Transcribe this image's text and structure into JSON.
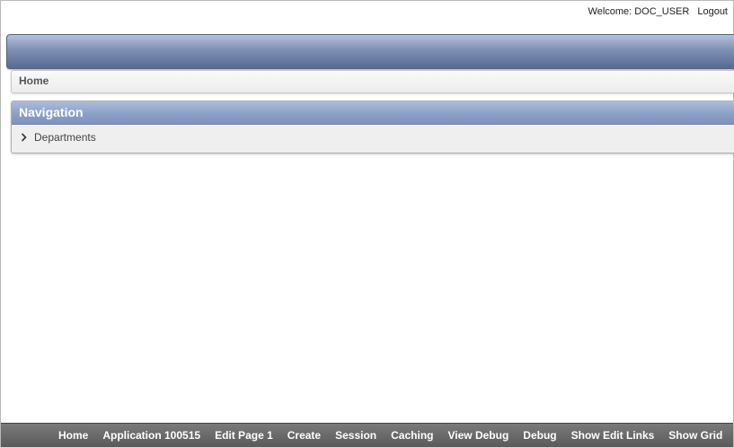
{
  "userbar": {
    "welcome_label": "Welcome:",
    "username": "DOC_USER",
    "logout_label": "Logout"
  },
  "breadcrumb": {
    "current": "Home"
  },
  "navigation": {
    "title": "Navigation",
    "items": [
      {
        "label": "Departments",
        "icon": "chevron-right-icon"
      }
    ]
  },
  "dev_toolbar": {
    "items": [
      {
        "label": "Home"
      },
      {
        "label": "Application 100515"
      },
      {
        "label": "Edit Page 1"
      },
      {
        "label": "Create"
      },
      {
        "label": "Session"
      },
      {
        "label": "Caching"
      },
      {
        "label": "View Debug"
      },
      {
        "label": "Debug"
      },
      {
        "label": "Show Edit Links"
      },
      {
        "label": "Show Grid"
      }
    ]
  },
  "colors": {
    "header_band": "#6f82ab",
    "region_header": "#8c9fc6",
    "toolbar": "#666666"
  }
}
